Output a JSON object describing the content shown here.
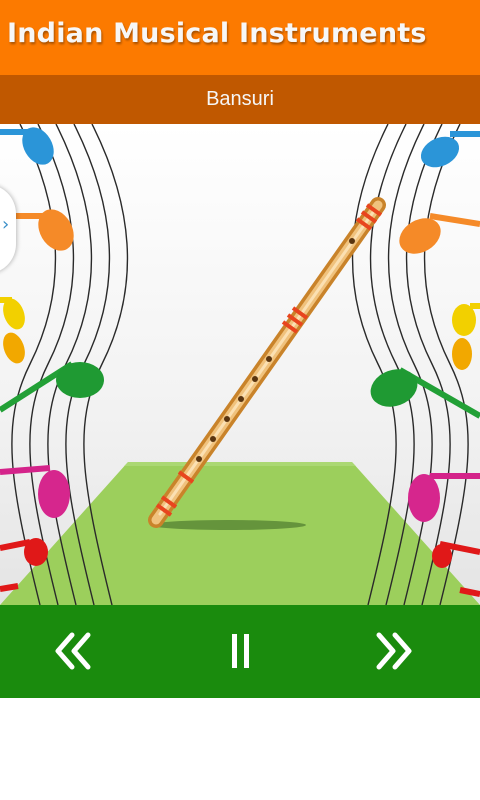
{
  "app": {
    "title": "Indian Musical Instruments"
  },
  "instrument": {
    "name": "Bansuri"
  },
  "controls": {
    "previous_icon": "double-chevron-left-icon",
    "pause_icon": "pause-icon",
    "next_icon": "double-chevron-right-icon"
  },
  "drawer": {
    "icon": "chevron-right-icon"
  },
  "colors": {
    "title_bar": "#fc7a00",
    "subtitle_bar": "#c05800",
    "control_bar": "#1a8b0d",
    "floor": "#9ccf5c"
  }
}
